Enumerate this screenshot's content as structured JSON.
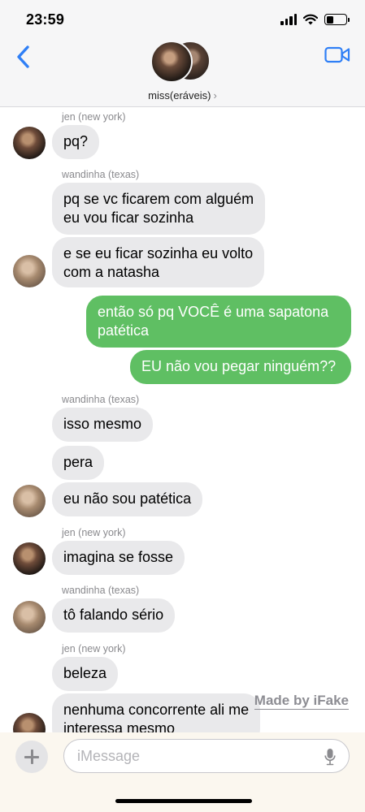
{
  "status_bar": {
    "time": "23:59",
    "battery_level": 0.35
  },
  "header": {
    "contact_name": "miss(eráveis)",
    "chevron": "›",
    "back_icon": "chevron-left-icon",
    "video_icon": "video-camera-icon"
  },
  "messages": [
    {
      "sender": "jen (new york)",
      "text": "pq?",
      "side": "in"
    },
    {
      "sender": "wandinha (texas)",
      "line1": "pq se vc ficarem com alguém",
      "line2": "eu vou ficar sozinha",
      "side": "in"
    },
    {
      "line1": "e se eu ficar sozinha eu volto",
      "line2": "com a natasha",
      "side": "in"
    },
    {
      "line1": "então só pq VOCÊ é uma sapatona",
      "line2": "patética",
      "side": "out"
    },
    {
      "text": "EU não vou pegar ninguém??",
      "side": "out"
    },
    {
      "sender": "wandinha (texas)",
      "text": "isso mesmo",
      "side": "in"
    },
    {
      "text": "pera",
      "side": "in"
    },
    {
      "text": "eu não sou patética",
      "side": "in"
    },
    {
      "sender": "jen (new york)",
      "text": "imagina se fosse",
      "side": "in"
    },
    {
      "sender": "wandinha (texas)",
      "text": "tô falando sério",
      "side": "in"
    },
    {
      "sender": "jen (new york)",
      "text": "beleza",
      "side": "in"
    },
    {
      "line1": "nenhuma concorrente ali me",
      "line2": "interessa mesmo",
      "side": "in"
    }
  ],
  "watermark": "Made by iFake",
  "composer": {
    "placeholder": "iMessage",
    "plus_icon": "plus-icon",
    "mic_icon": "microphone-icon"
  },
  "colors": {
    "incoming": "#e9e9eb",
    "outgoing": "#5fbf63",
    "accent": "#2f7ff6"
  }
}
